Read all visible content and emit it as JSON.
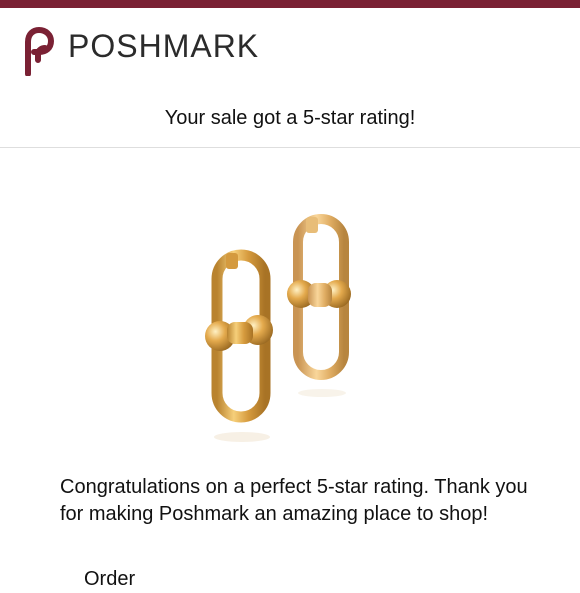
{
  "brand": {
    "name": "POSHMARK",
    "color": "#7a2134"
  },
  "email": {
    "headline": "Your sale got a 5-star rating!",
    "message": "Congratulations on a perfect 5-star rating. Thank you for making Poshmark an amazing place to shop!",
    "order_label": "Order"
  },
  "product_image": {
    "icon": "gold-link-earrings-image"
  }
}
